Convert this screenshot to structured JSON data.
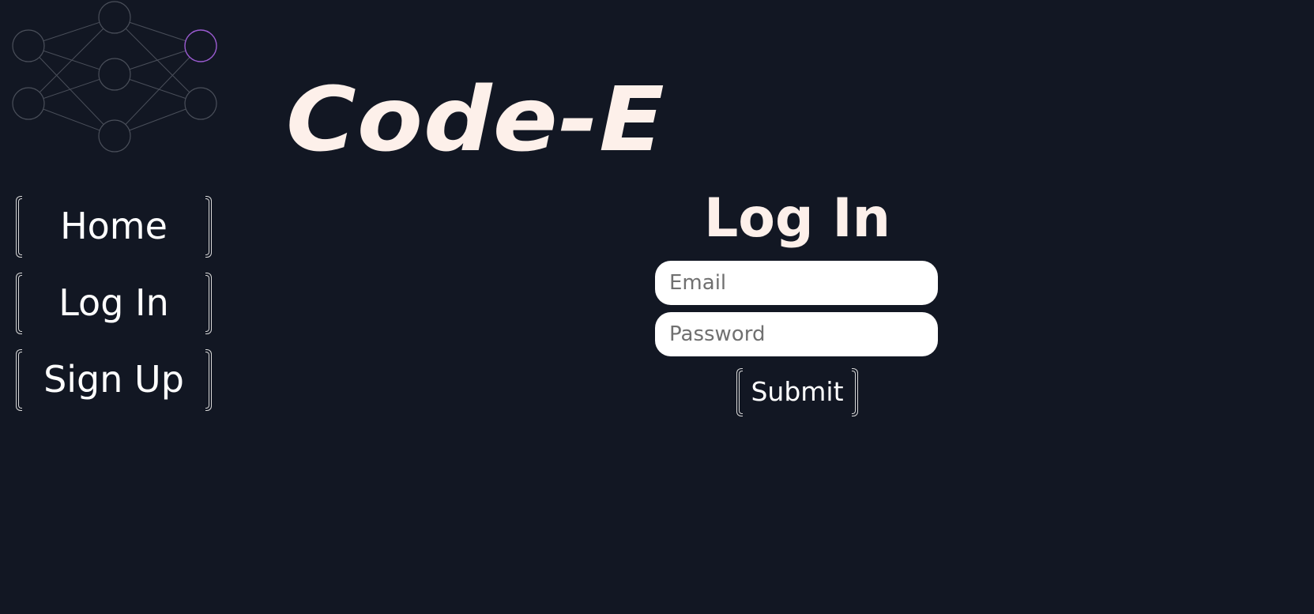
{
  "brand": {
    "title": "Code-E"
  },
  "logo": {
    "icon": "neural-network-icon",
    "node_color": "#4a4f5a",
    "highlight_color": "#9b5bd1"
  },
  "nav": {
    "items": [
      {
        "label": "Home"
      },
      {
        "label": "Log In"
      },
      {
        "label": "Sign Up"
      }
    ]
  },
  "login": {
    "heading": "Log In",
    "email_placeholder": "Email",
    "password_placeholder": "Password",
    "submit_label": "Submit"
  },
  "colors": {
    "background": "#121723",
    "title": "#fdf0ea",
    "text": "#ffffff"
  }
}
